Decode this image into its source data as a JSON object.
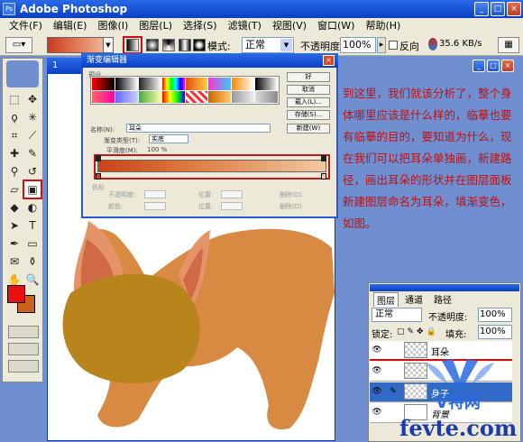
{
  "app": {
    "title": "Adobe Photoshop",
    "icon": "Ps"
  },
  "window_buttons": {
    "min": "_",
    "max": "□",
    "close": "×"
  },
  "menu": [
    "文件(F)",
    "编辑(E)",
    "图像(I)",
    "图层(L)",
    "选择(S)",
    "滤镜(T)",
    "视图(V)",
    "窗口(W)",
    "帮助(H)"
  ],
  "options": {
    "mode_label": "模式:",
    "mode_value": "正常",
    "opacity_label": "不透明度:",
    "opacity_value": "100%",
    "reverse_label": "反向",
    "net_speed": "35.6 KB/s"
  },
  "document": {
    "title": "1"
  },
  "gradient_editor": {
    "title": "渐变编辑器",
    "preset_label": "预设",
    "buttons": [
      "好",
      "取消",
      "载入(L)...",
      "存储(S)..."
    ],
    "name_label": "名称(N):",
    "name_value": "耳朵",
    "new_button": "新建(W)",
    "type_label": "渐变类型(T):",
    "type_value": "实底",
    "smooth_label": "平滑度(M):",
    "smooth_value": "100 %",
    "stops_label": "色标",
    "stop_fields": [
      "不透明度:",
      "位置:",
      "删除(D)",
      "颜色:",
      "位置:",
      "删除(D)"
    ]
  },
  "description": "到这里，我们就该分析了，整个身体哪里应该是什么样的，临摹也要有临摹的目的，要知道为什么，现在我们可以把耳朵单独画，新建路径，画出耳朵的形状并在图层面板新建图层命名为耳朵，填渐变色，如图。",
  "layers_panel": {
    "tabs": [
      "图层",
      "通道",
      "路径"
    ],
    "blend": "正常",
    "opacity_label": "不透明度:",
    "opacity": "100%",
    "lock_label": "锁定:",
    "fill_label": "填充:",
    "fill": "100%",
    "layers": [
      {
        "name": "耳朵"
      },
      {
        "name": ""
      },
      {
        "name": "身子"
      },
      {
        "name": "背景"
      }
    ]
  },
  "watermark": {
    "text": "V特网",
    "url": "fevte.com"
  },
  "colors": {
    "foreground": "#e81010",
    "background": "#c8621c",
    "body": "#d98a42",
    "head": "#b8841c",
    "ear": "#d06a44"
  }
}
